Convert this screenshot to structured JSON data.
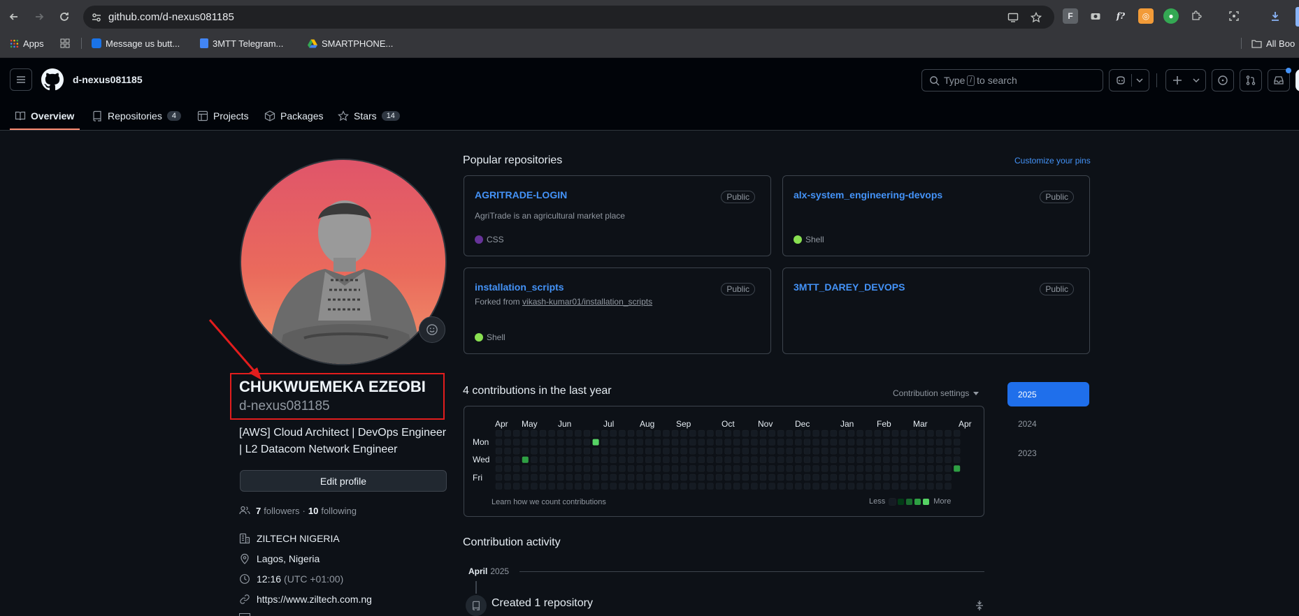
{
  "browser": {
    "url": "github.com/d-nexus081185",
    "bookmarks": [
      "Apps",
      "Message us butt...",
      "3MTT Telegram...",
      "SMARTPHONE...",
      "All Boo"
    ]
  },
  "header": {
    "username": "d-nexus081185",
    "search_prefix": "Type",
    "search_key": "/",
    "search_suffix": "to search"
  },
  "tabs": [
    {
      "label": "Overview",
      "count": ""
    },
    {
      "label": "Repositories",
      "count": "4"
    },
    {
      "label": "Projects",
      "count": ""
    },
    {
      "label": "Packages",
      "count": ""
    },
    {
      "label": "Stars",
      "count": "14"
    }
  ],
  "profile": {
    "name": "CHUKWUEMEKA EZEOBI",
    "login": "d-nexus081185",
    "bio_line1": "[AWS] Cloud Architect | DevOps Engineer",
    "bio_line2": "| L2 Datacom Network Engineer",
    "edit_button": "Edit profile",
    "followers_count": "7",
    "followers_label": "followers",
    "following_count": "10",
    "following_label": "following",
    "company": "ZILTECH NIGERIA",
    "location": "Lagos, Nigeria",
    "time": "12:16",
    "timezone": "(UTC +01:00)",
    "website": "https://www.ziltech.com.ng"
  },
  "popular": {
    "title": "Popular repositories",
    "customize": "Customize your pins",
    "repos": [
      {
        "name": "AGRITRADE-LOGIN",
        "visibility": "Public",
        "description": "AgriTrade is an agricultural market place",
        "language": "CSS",
        "lang_color": "#663399"
      },
      {
        "name": "alx-system_engineering-devops",
        "visibility": "Public",
        "description": "",
        "language": "Shell",
        "lang_color": "#89e051"
      },
      {
        "name": "installation_scripts",
        "visibility": "Public",
        "forked_prefix": "Forked from",
        "forked_from": "vikash-kumar01/installation_scripts",
        "language": "Shell",
        "lang_color": "#89e051"
      },
      {
        "name": "3MTT_DAREY_DEVOPS",
        "visibility": "Public",
        "description": "",
        "language": "",
        "lang_color": ""
      }
    ]
  },
  "contributions": {
    "title": "4 contributions in the last year",
    "settings": "Contribution settings",
    "months": [
      "Apr",
      "May",
      "Jun",
      "Jul",
      "Aug",
      "Sep",
      "Oct",
      "Nov",
      "Dec",
      "Jan",
      "Feb",
      "Mar",
      "Apr"
    ],
    "days": [
      "Mon",
      "Wed",
      "Fri"
    ],
    "learn": "Learn how we count contributions",
    "less": "Less",
    "more": "More",
    "empty_color": "#151b23",
    "levels": [
      "#151b23",
      "#033a16",
      "#196c2e",
      "#2ea043",
      "#56d364"
    ],
    "active_cells": [
      {
        "week": 11,
        "day": 1,
        "level": 4
      },
      {
        "week": 3,
        "day": 3,
        "level": 3
      },
      {
        "week": 52,
        "day": 4,
        "level": 3
      }
    ]
  },
  "years": [
    "2025",
    "2024",
    "2023"
  ],
  "activity": {
    "title": "Contribution activity",
    "month": "April",
    "year": "2025",
    "item": "Created 1 repository"
  }
}
